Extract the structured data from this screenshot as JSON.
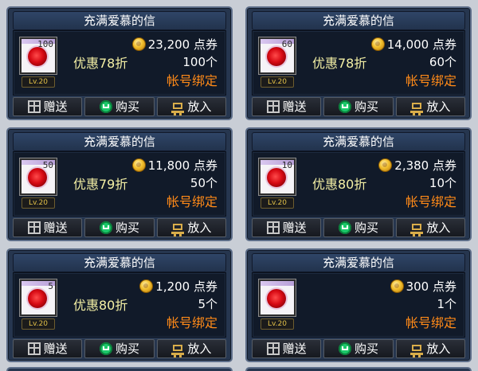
{
  "colors": {
    "card_bg": "#26364f",
    "card_border": "#5c6d88",
    "body_bg": "#111a29",
    "discount": "#f4f0a5",
    "bind": "#ff8a18",
    "level": "#e2c048"
  },
  "shop": {
    "items": [
      {
        "title": "充满爱慕的信",
        "icon_count": "100",
        "level": "Lv.20",
        "price": "23,200 点券",
        "discount": "优惠78折",
        "quantity": "100个",
        "binding": "帐号绑定",
        "gift_label": "赠送",
        "buy_label": "购买",
        "cart_label": "放入"
      },
      {
        "title": "充满爱慕的信",
        "icon_count": "60",
        "level": "Lv.20",
        "price": "14,000 点券",
        "discount": "优惠78折",
        "quantity": "60个",
        "binding": "帐号绑定",
        "gift_label": "赠送",
        "buy_label": "购买",
        "cart_label": "放入"
      },
      {
        "title": "充满爱慕的信",
        "icon_count": "50",
        "level": "Lv.20",
        "price": "11,800 点券",
        "discount": "优惠79折",
        "quantity": "50个",
        "binding": "帐号绑定",
        "gift_label": "赠送",
        "buy_label": "购买",
        "cart_label": "放入"
      },
      {
        "title": "充满爱慕的信",
        "icon_count": "10",
        "level": "Lv.20",
        "price": "2,380 点券",
        "discount": "优惠80折",
        "quantity": "10个",
        "binding": "帐号绑定",
        "gift_label": "赠送",
        "buy_label": "购买",
        "cart_label": "放入"
      },
      {
        "title": "充满爱慕的信",
        "icon_count": "5",
        "level": "Lv.20",
        "price": "1,200 点券",
        "discount": "优惠80折",
        "quantity": "5个",
        "binding": "帐号绑定",
        "gift_label": "赠送",
        "buy_label": "购买",
        "cart_label": "放入"
      },
      {
        "title": "充满爱慕的信",
        "icon_count": "",
        "level": "Lv.20",
        "price": "300 点券",
        "discount": "",
        "quantity": "1个",
        "binding": "帐号绑定",
        "gift_label": "赠送",
        "buy_label": "购买",
        "cart_label": "放入"
      }
    ]
  }
}
